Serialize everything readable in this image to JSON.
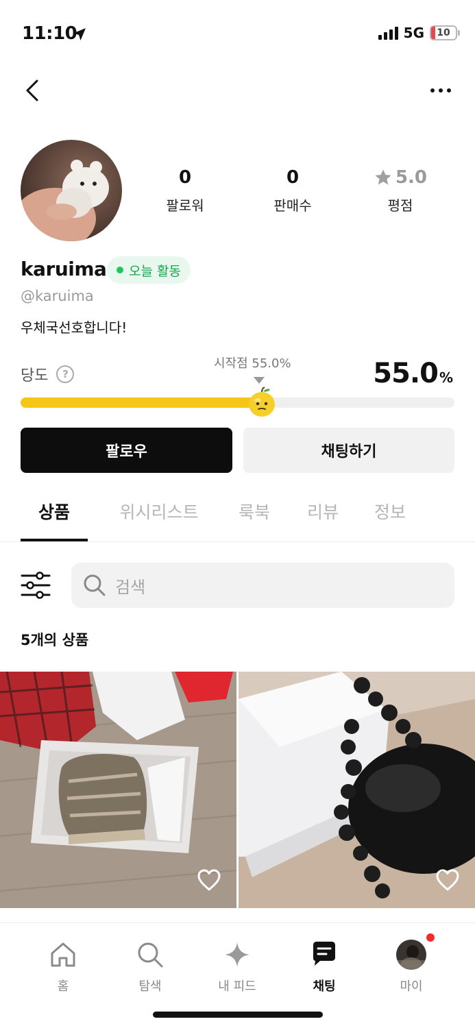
{
  "status_bar": {
    "time": "11:10",
    "network": "5G",
    "battery": "10"
  },
  "profile": {
    "username": "karuima",
    "handle": "@karuima",
    "bio": "우체국선호합니다!",
    "active_badge": "오늘 활동",
    "stats": [
      {
        "value": "0",
        "label": "팔로워"
      },
      {
        "value": "0",
        "label": "판매수"
      },
      {
        "value": "5.0",
        "label": "평점"
      }
    ]
  },
  "sweetness": {
    "label": "당도",
    "help_icon": "?",
    "start_label": "시작점 55.0%",
    "value": "55.0",
    "unit": "%",
    "level": 0.55
  },
  "buttons": {
    "follow": "팔로우",
    "chat": "채팅하기"
  },
  "tabs": [
    "상품",
    "위시리스트",
    "룩북",
    "리뷰",
    "정보"
  ],
  "search": {
    "placeholder": "검색"
  },
  "product_count": "5개의 상품",
  "bottom_nav": [
    {
      "label": "홈"
    },
    {
      "label": "탐색"
    },
    {
      "label": "내 피드"
    },
    {
      "label": "채팅"
    },
    {
      "label": "마이"
    }
  ],
  "colors": {
    "accent": "#f5c518",
    "active_green": "#16a34a",
    "notification": "#ef2b2b"
  }
}
